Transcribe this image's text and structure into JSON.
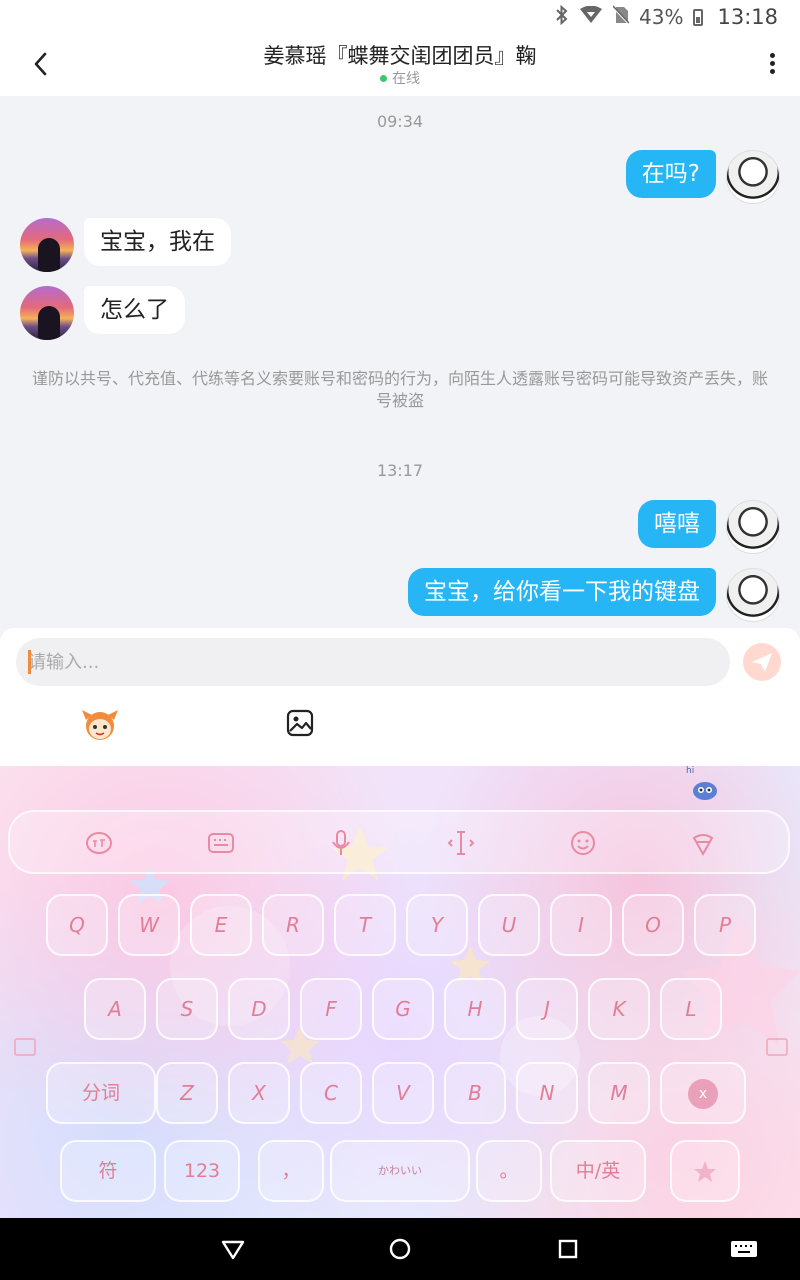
{
  "status_bar": {
    "battery": "43%",
    "time": "13:18"
  },
  "header": {
    "title": "姜慕瑶『蝶舞交闺团团员』鞠",
    "status": "在线"
  },
  "chat": {
    "timestamp1": "09:34",
    "msg1": "在吗?",
    "msg2": "宝宝，我在",
    "msg3": "怎么了",
    "notice": "谨防以共号、代充值、代练等名义索要账号和密码的行为，向陌生人透露账号密码可能导致资产丢失，账号被盗",
    "timestamp2": "13:17",
    "msg4": "嘻嘻",
    "msg5": "宝宝，给你看一下我的键盘"
  },
  "input": {
    "placeholder": "请输入..."
  },
  "keyboard": {
    "hi_badge": "hi",
    "row1": [
      "Q",
      "W",
      "E",
      "R",
      "T",
      "Y",
      "U",
      "I",
      "O",
      "P"
    ],
    "row2": [
      "A",
      "S",
      "D",
      "F",
      "G",
      "H",
      "J",
      "K",
      "L"
    ],
    "row3": [
      "Z",
      "X",
      "C",
      "V",
      "B",
      "N",
      "M"
    ],
    "segment_key": "分词",
    "symbol_key": "符",
    "number_key": "123",
    "comma_key": "，",
    "space_key": "かわいい",
    "period_key": "。",
    "lang_key": "中/英",
    "delete_key": "x"
  },
  "colors": {
    "accent": "#27b6f5",
    "online": "#3cc76c",
    "key_text": "#e27d96"
  }
}
